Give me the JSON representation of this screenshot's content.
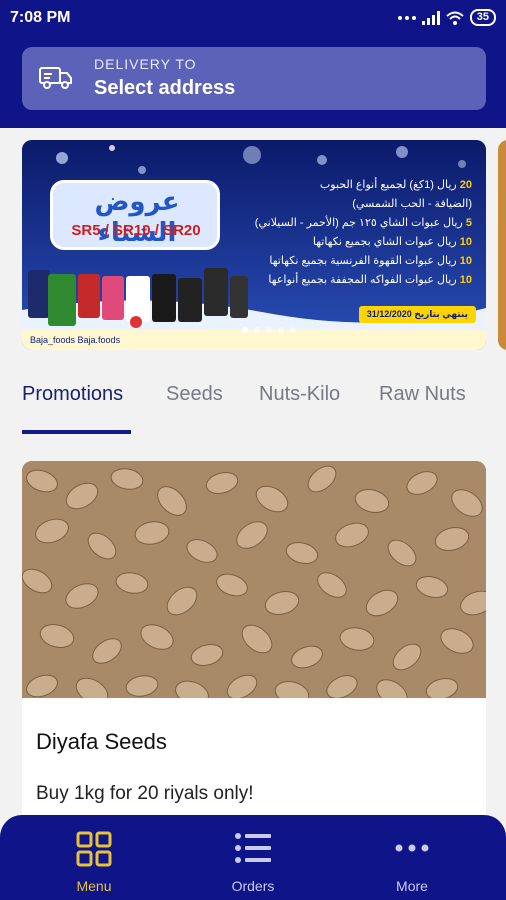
{
  "status_bar": {
    "time": "7:08 PM",
    "battery": "35"
  },
  "delivery": {
    "label": "DELIVERY TO",
    "address": "Select address"
  },
  "banner": {
    "title": "عروض الشتاء",
    "prices": "SR5 / SR10 / SR20",
    "lines": [
      {
        "price": "20",
        "text": "ريال (1كغ) لجميع أنواع الحبوب"
      },
      {
        "price": "",
        "text": "(الضيافة - الحب الشمسي)"
      },
      {
        "price": "5",
        "text": "ريال عبوات الشاي ١٢٥ جم (الأحمر - السيلاني)"
      },
      {
        "price": "10",
        "text": "ريال عبوات الشاي بجميع نكهاتها"
      },
      {
        "price": "10",
        "text": "ريال عبوات القهوة الفرنسية بجميع نكهاتها"
      },
      {
        "price": "10",
        "text": "ريال عبوات الفواكه المجففة بجميع أنواعها"
      }
    ],
    "end_date": "ينتهي بتاريخ 31/12/2020",
    "social": "Baja_foods  Baja.foods"
  },
  "tabs": [
    "Promotions",
    "Seeds",
    "Nuts-Kilo",
    "Raw Nuts"
  ],
  "product": {
    "title": "Diyafa Seeds",
    "description": "Buy 1kg for 20 riyals only!"
  },
  "bottom_nav": [
    {
      "label": "Menu",
      "icon": "grid-icon",
      "active": true
    },
    {
      "label": "Orders",
      "icon": "list-icon",
      "active": false
    },
    {
      "label": "More",
      "icon": "more-dots-icon",
      "active": false
    }
  ],
  "colors": {
    "primary": "#0f1488",
    "accent": "#e7c23a",
    "delivery_box": "#5b62b8"
  }
}
